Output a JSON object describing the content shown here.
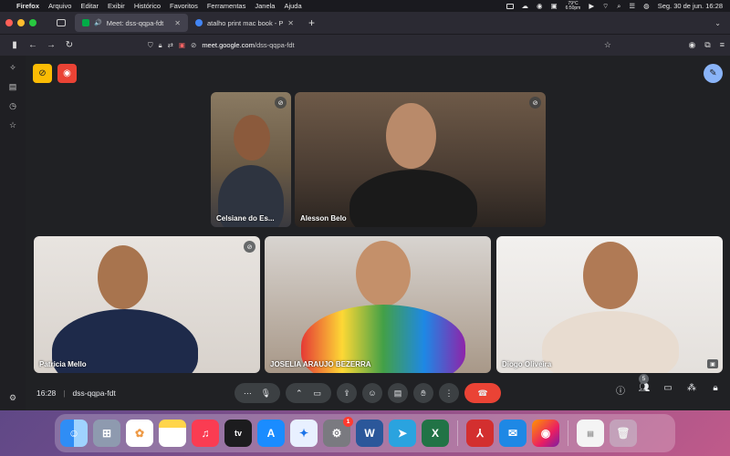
{
  "menubar": {
    "app": "Firefox",
    "items": [
      "Arquivo",
      "Editar",
      "Exibir",
      "Histórico",
      "Favoritos",
      "Ferramentas",
      "Janela",
      "Ajuda"
    ],
    "weather_temp": "79°C",
    "weather_time": "6:50pm",
    "datetime": "Seg. 30 de jun.  16:28"
  },
  "browser": {
    "tabs": [
      {
        "title": "Meet: dss-qqpa-fdt",
        "active": true
      },
      {
        "title": "atalho print mac book - Pesqui",
        "active": false
      }
    ],
    "url_domain": "meet.google.com",
    "url_path": "/dss-qqpa-fdt"
  },
  "meet": {
    "participants": [
      {
        "name": "Celsiane do Es..."
      },
      {
        "name": "Alesson Belo"
      },
      {
        "name": "Patricia Mello"
      },
      {
        "name": "JOSELIA ARAUJO BEZERRA"
      },
      {
        "name": "Diogo Oliveira"
      }
    ],
    "time": "16:28",
    "code": "dss-qqpa-fdt",
    "people_count": "5"
  },
  "dock": {
    "settings_badge": "1",
    "apps": [
      "finder-icon",
      "launchpad-icon",
      "photos-icon",
      "notes-icon",
      "music-icon",
      "appletv-icon",
      "appstore-icon",
      "safari-icon",
      "settings-icon",
      "word-icon",
      "telegram-icon",
      "excel-icon",
      "acrobat-icon",
      "mail-icon",
      "firefox-icon",
      "document-icon",
      "trash-icon"
    ]
  },
  "colors": {
    "meet_bg": "#202124",
    "end_call": "#ea4335",
    "effects_accent": "#8ab4f8"
  }
}
